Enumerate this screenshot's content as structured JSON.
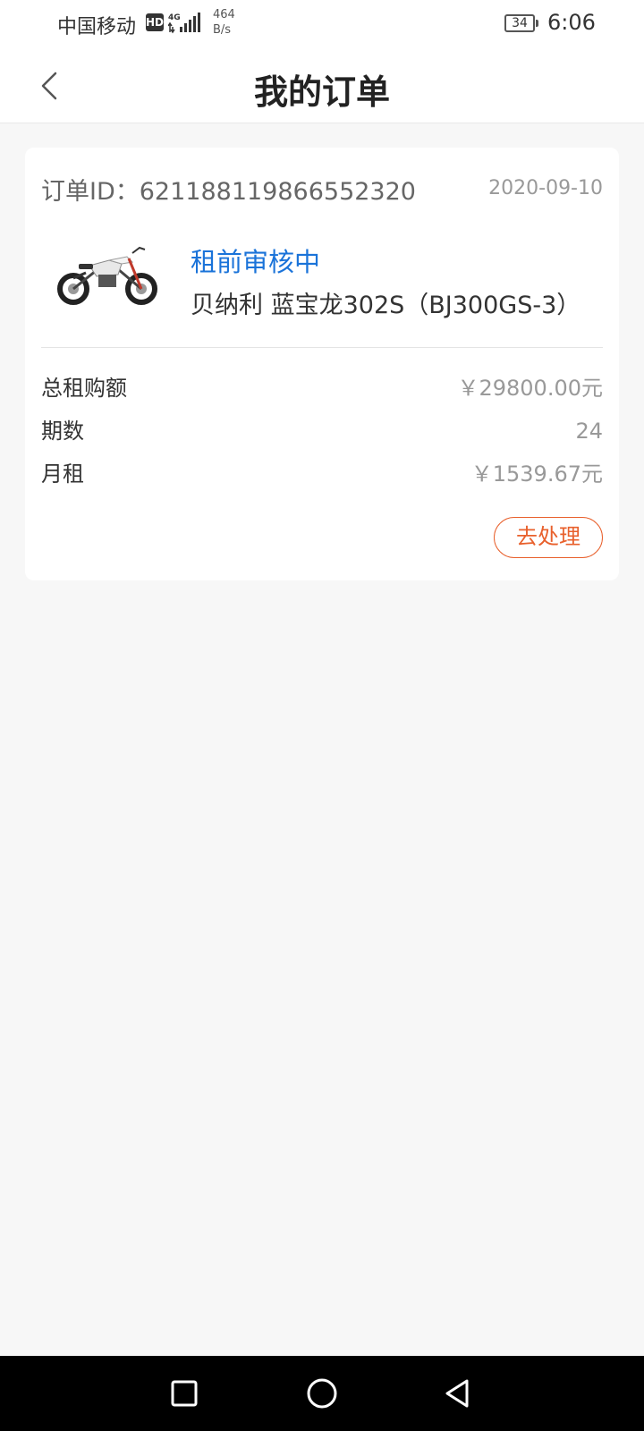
{
  "status_bar": {
    "carrier": "中国移动",
    "hd": "HD",
    "net_speed_value": "464",
    "net_speed_unit": "B/s",
    "battery": "34",
    "time": "6:06"
  },
  "header": {
    "title": "我的订单"
  },
  "order": {
    "id_label": "订单ID：621188119866552320",
    "date": "2020-09-10",
    "status": "租前审核中",
    "product_name": "贝纳利 蓝宝龙302S（BJ300GS-3）",
    "details": {
      "total_label": "总租购额",
      "total_value": "￥29800.00元",
      "terms_label": "期数",
      "terms_value": "24",
      "monthly_label": "月租",
      "monthly_value": "￥1539.67元"
    },
    "action_label": "去处理"
  },
  "colors": {
    "accent_blue": "#1a73d9",
    "action_orange": "#e8602c"
  },
  "icons": {
    "back": "chevron-left-icon",
    "recent": "square-icon",
    "home": "circle-icon",
    "system_back": "triangle-left-icon"
  }
}
